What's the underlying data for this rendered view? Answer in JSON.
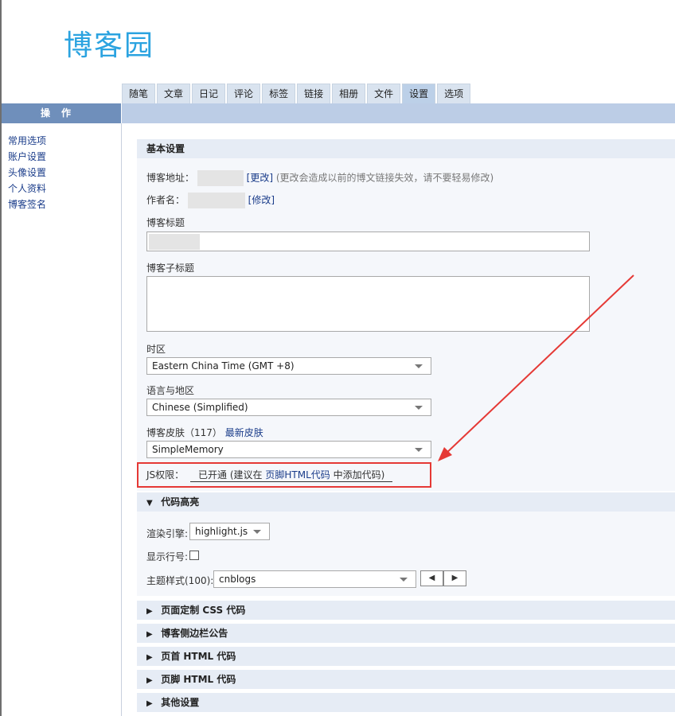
{
  "logo_text": "博客园",
  "tabs": [
    {
      "label": "随笔"
    },
    {
      "label": "文章"
    },
    {
      "label": "日记"
    },
    {
      "label": "评论"
    },
    {
      "label": "标签"
    },
    {
      "label": "链接"
    },
    {
      "label": "相册"
    },
    {
      "label": "文件"
    },
    {
      "label": "设置"
    },
    {
      "label": "选项"
    }
  ],
  "active_tab": "设置",
  "sidebar": {
    "heading": "操作",
    "items": [
      {
        "label": "常用选项"
      },
      {
        "label": "账户设置"
      },
      {
        "label": "头像设置"
      },
      {
        "label": "个人资料"
      },
      {
        "label": "博客签名"
      }
    ]
  },
  "basic": {
    "title": "基本设置",
    "blog_address_label": "博客地址：",
    "blog_address_change": "[更改]",
    "blog_address_hint": "(更改会造成以前的博文链接失效，请不要轻易修改)",
    "author_label": "作者名：",
    "author_edit": "[修改]",
    "blog_title_label": "博客标题",
    "blog_subtitle_label": "博客子标题",
    "timezone_label": "时区",
    "timezone_value": "Eastern China Time (GMT +8)",
    "language_label": "语言与地区",
    "language_value": "Chinese (Simplified)",
    "skin_label": "博客皮肤（117）",
    "skin_link": "最新皮肤",
    "skin_value": "SimpleMemory",
    "js_label": "JS权限：",
    "js_status": "已开通",
    "js_hint_pre": "(建议在",
    "js_hint_link": "页脚HTML代码",
    "js_hint_post": "中添加代码)"
  },
  "code_highlight": {
    "title": "代码高亮",
    "engine_label": "渲染引擎:",
    "engine_value": "highlight.js",
    "line_numbers_label": "显示行号:",
    "line_numbers_checked": false,
    "theme_label": "主题样式(100):",
    "theme_value": "cnblogs",
    "prev_icon": "◀",
    "next_icon": "▶"
  },
  "collapsed_sections": [
    {
      "label": "页面定制 CSS 代码"
    },
    {
      "label": "博客侧边栏公告"
    },
    {
      "label": "页首 HTML 代码"
    },
    {
      "label": "页脚 HTML 代码"
    },
    {
      "label": "其他设置"
    }
  ],
  "colors": {
    "accent": "#2ba3e0",
    "highlight_box": "#e53935",
    "link": "#1a3c8a"
  }
}
